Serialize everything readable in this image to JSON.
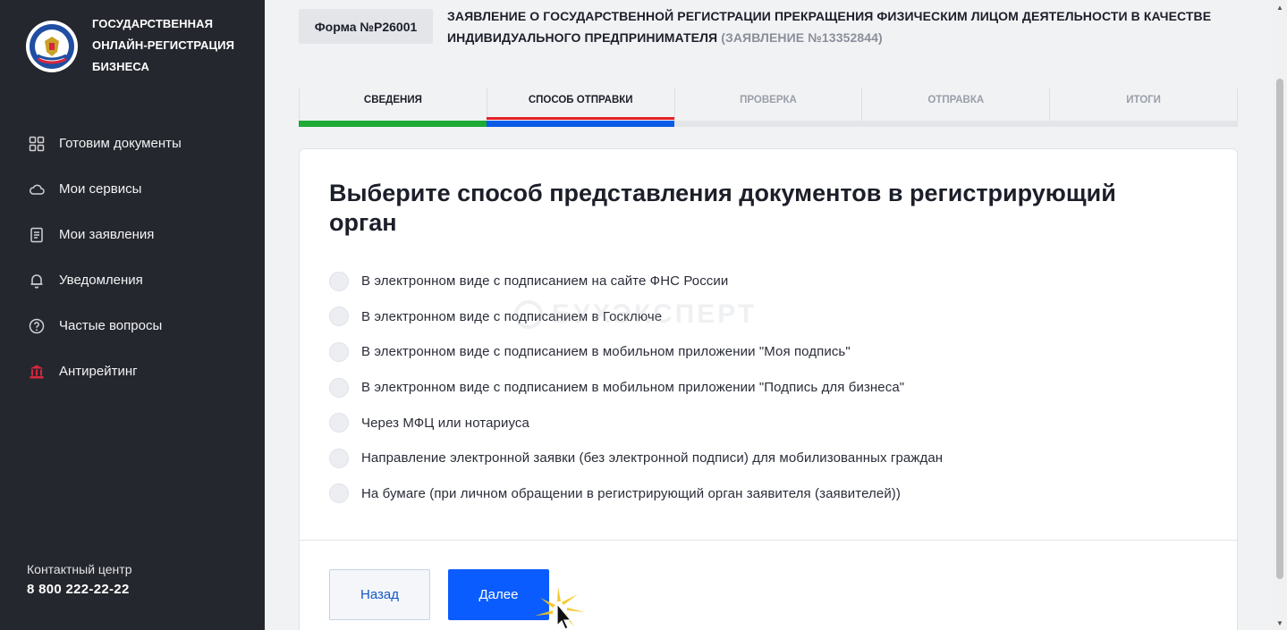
{
  "sidebar": {
    "brand_lines": [
      "ГОСУДАРСТВЕННАЯ",
      "ОНЛАЙН-РЕГИСТРАЦИЯ",
      "БИЗНЕСА"
    ],
    "items": [
      {
        "label": "Готовим документы",
        "icon": "grid-icon"
      },
      {
        "label": "Мои сервисы",
        "icon": "cloud-icon"
      },
      {
        "label": "Мои заявления",
        "icon": "document-icon"
      },
      {
        "label": "Уведомления",
        "icon": "bell-icon"
      },
      {
        "label": "Частые вопросы",
        "icon": "question-icon"
      },
      {
        "label": "Антирейтинг",
        "icon": "bank-icon"
      }
    ],
    "contact_label": "Контактный центр",
    "contact_phone": "8 800 222-22-22"
  },
  "header": {
    "form_badge": "Форма №Р26001",
    "title": "ЗАЯВЛЕНИЕ О ГОСУДАРСТВЕННОЙ РЕГИСТРАЦИИ ПРЕКРАЩЕНИЯ ФИЗИЧЕСКИМ ЛИЦОМ ДЕЯТЕЛЬНОСТИ В КАЧЕСТВЕ ИНДИВИДУАЛЬНОГО ПРЕДПРИНИМАТЕЛЯ",
    "application_number": "(ЗАЯВЛЕНИЕ №13352844)"
  },
  "tabs": [
    {
      "label": "СВЕДЕНИЯ",
      "state": "done"
    },
    {
      "label": "СПОСОБ ОТПРАВКИ",
      "state": "active"
    },
    {
      "label": "ПРОВЕРКА",
      "state": "pending"
    },
    {
      "label": "ОТПРАВКА",
      "state": "pending"
    },
    {
      "label": "ИТОГИ",
      "state": "pending"
    }
  ],
  "main": {
    "heading": "Выберите способ представления документов в регистрирующий орган",
    "options": [
      "В электронном виде с подписанием на сайте ФНС России",
      "В электронном виде с подписанием в Госключе",
      "В электронном виде с подписанием в мобильном приложении \"Моя подпись\"",
      "В электронном виде с подписанием в мобильном приложении \"Подпись для бизнеса\"",
      "Через МФЦ или нотариуса",
      "Направление электронной заявки (без электронной подписи) для мобилизованных граждан",
      "На бумаге (при личном обращении в регистрирующий орган заявителя (заявителей))"
    ],
    "back_label": "Назад",
    "next_label": "Далее"
  },
  "watermark": "БУХЭКСПЕРТ",
  "colors": {
    "sidebar_bg": "#25272e",
    "primary": "#0b5cff",
    "tab_done": "#1eaa36",
    "tab_active": "#0b5ce6",
    "tab_active_top": "#e32128"
  }
}
